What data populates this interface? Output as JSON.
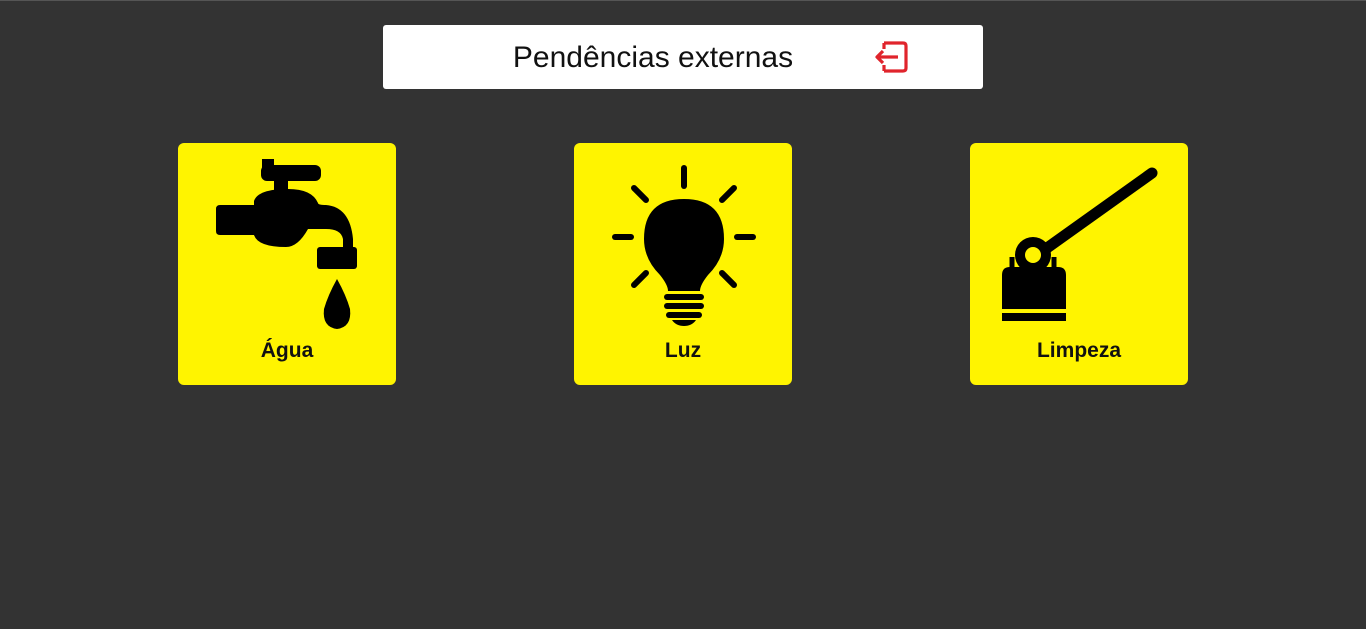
{
  "header": {
    "title": "Pendências externas",
    "logout_icon": "logout-icon",
    "logout_color": "#e0242c"
  },
  "theme": {
    "background": "#333333",
    "card_color": "#fff400",
    "icon_color": "#000000"
  },
  "cards": [
    {
      "label": "Água",
      "icon": "faucet-icon"
    },
    {
      "label": "Luz",
      "icon": "lightbulb-icon"
    },
    {
      "label": "Limpeza",
      "icon": "mop-icon"
    }
  ]
}
